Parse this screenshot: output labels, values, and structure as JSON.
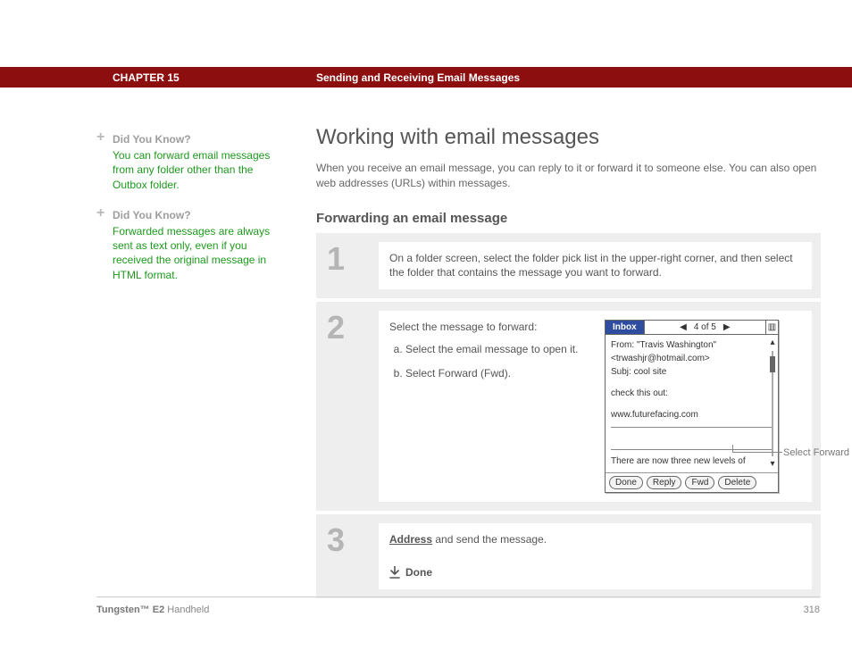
{
  "header": {
    "chapter": "CHAPTER 15",
    "title": "Sending and Receiving Email Messages"
  },
  "sidebar": {
    "tips": [
      {
        "heading": "Did You Know?",
        "body": "You can forward email messages from any folder other than the Outbox folder."
      },
      {
        "heading": "Did You Know?",
        "body": "Forwarded messages are always sent as text only, even if you received the original message in HTML format."
      }
    ]
  },
  "main": {
    "h1": "Working with email messages",
    "intro": "When you receive an email message, you can reply to it or forward it to someone else. You can also open web addresses (URLs) within messages.",
    "h2": "Forwarding an email message",
    "steps": {
      "s1": {
        "num": "1",
        "text": "On a folder screen, select the folder pick list in the upper-right corner, and then select the folder that contains the message you want to forward."
      },
      "s2": {
        "num": "2",
        "lead": "Select the message to forward:",
        "a": "Select the email message to open it.",
        "b": "Select Forward (Fwd).",
        "caption": "Select Forward"
      },
      "s3": {
        "num": "3",
        "link": "Address",
        "rest": " and send the message.",
        "done": "Done"
      }
    }
  },
  "device": {
    "titlebar": {
      "inbox": "Inbox",
      "counter": "4 of 5"
    },
    "from_label": "From:",
    "from_name": "\"Travis Washington\"",
    "from_email": "<trwashjr@hotmail.com>",
    "subj_label": "Subj:",
    "subj_value": "cool site",
    "body1": "check this out:",
    "body2": "www.futurefacing.com",
    "cont": "There are now three new levels of",
    "buttons": {
      "done": "Done",
      "reply": "Reply",
      "fwd": "Fwd",
      "delete": "Delete"
    }
  },
  "footer": {
    "product_bold": "Tungsten™ E2",
    "product_rest": " Handheld",
    "page": "318"
  }
}
